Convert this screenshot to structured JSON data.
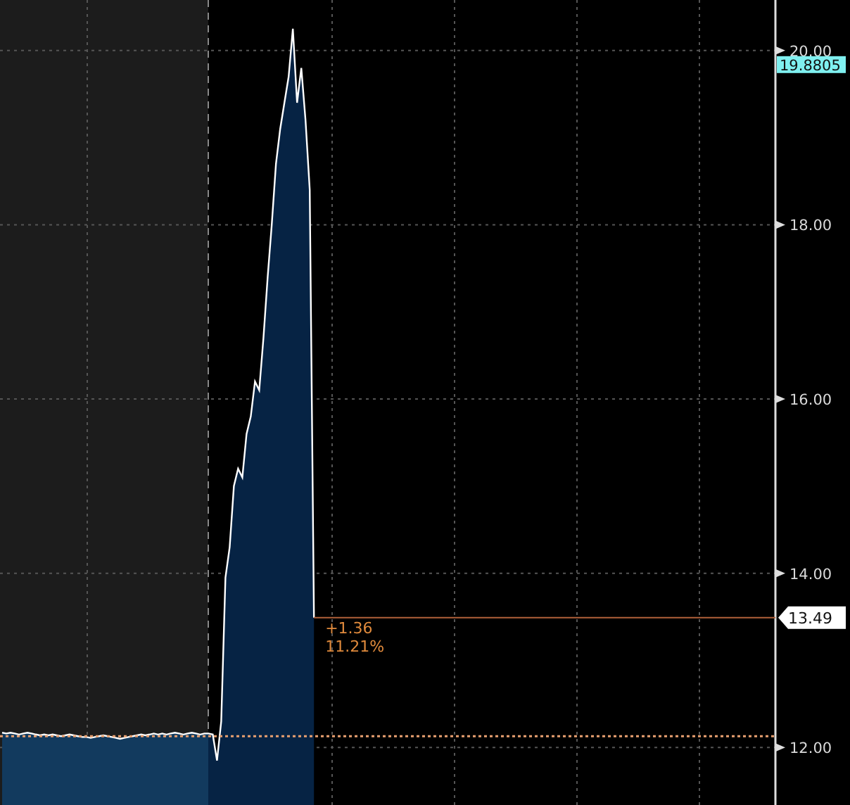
{
  "chart_data": {
    "type": "area",
    "ylim": [
      11.34,
      20.58
    ],
    "grid": true,
    "yticks": [
      {
        "value": 12,
        "label": "12.00"
      },
      {
        "value": 14,
        "label": "14.00"
      },
      {
        "value": 16,
        "label": "16.00"
      },
      {
        "value": 18,
        "label": "18.00"
      },
      {
        "value": 20,
        "label": "20.00"
      }
    ],
    "categories": [
      null,
      null,
      null,
      null,
      null,
      null,
      null,
      null,
      null,
      null,
      null,
      null,
      null,
      null,
      null,
      null,
      null,
      null,
      null,
      null,
      null,
      null,
      null,
      null,
      null,
      null,
      null,
      null,
      null,
      null,
      null,
      null,
      null,
      null,
      null,
      null,
      null,
      null,
      null,
      null,
      null,
      null,
      null,
      null,
      null,
      null,
      null,
      null,
      null,
      null,
      null,
      null,
      null,
      null,
      null,
      null,
      null,
      null,
      null,
      null,
      null,
      null,
      null,
      null,
      null,
      null,
      null,
      null,
      null,
      null,
      null,
      null,
      null,
      null,
      null,
      null,
      null,
      null,
      null,
      null,
      null,
      null,
      null,
      null,
      null,
      null,
      null,
      null,
      null,
      null,
      null,
      null,
      null,
      null,
      null,
      null,
      null,
      null,
      null,
      null,
      null,
      null,
      null,
      null,
      null,
      null,
      null,
      null,
      null,
      null,
      null,
      null,
      null,
      null,
      null,
      null,
      null,
      null,
      null,
      null,
      null,
      null,
      null,
      null,
      null,
      null,
      null,
      null,
      null,
      null,
      null,
      null,
      null,
      null,
      null,
      null,
      null,
      null,
      null,
      null,
      null,
      null,
      null,
      null,
      null,
      null,
      null,
      null,
      null,
      null,
      null,
      null,
      null,
      null,
      null,
      null,
      null,
      null,
      null,
      null,
      null,
      null,
      null,
      null,
      null,
      null,
      null,
      null,
      null,
      null,
      null,
      null,
      null,
      null,
      null,
      null,
      null,
      null,
      null,
      null,
      null,
      null,
      null,
      null
    ],
    "series": [
      {
        "color": "#ffffff",
        "values": [
          12.17,
          12.16,
          12.17,
          12.16,
          12.15,
          12.16,
          12.17,
          12.16,
          12.15,
          12.14,
          12.15,
          12.14,
          12.15,
          12.14,
          12.13,
          12.14,
          12.15,
          12.14,
          12.13,
          12.12,
          12.12,
          12.11,
          12.12,
          12.13,
          12.14,
          12.13,
          12.12,
          12.11,
          12.1,
          12.11,
          12.12,
          12.13,
          12.14,
          12.15,
          12.14,
          12.15,
          12.16,
          12.15,
          12.16,
          12.15,
          12.16,
          12.17,
          12.16,
          12.15,
          12.16,
          12.17,
          12.16,
          12.15,
          12.16,
          12.16,
          12.15,
          11.85,
          12.3,
          13.95,
          14.3,
          15.0,
          15.2,
          15.1,
          15.6,
          15.8,
          16.2,
          16.1,
          16.7,
          17.4,
          18.0,
          18.7,
          19.1,
          19.4,
          19.7,
          20.25,
          19.4,
          19.8,
          19.2,
          18.4,
          13.49,
          null,
          null,
          null,
          null,
          null,
          null,
          null,
          null,
          null,
          null,
          null,
          null,
          null,
          null,
          null,
          null,
          null,
          null,
          null,
          null,
          null,
          null,
          null,
          null,
          null,
          null,
          null,
          null,
          null,
          null,
          null,
          null,
          null,
          null,
          null,
          null,
          null,
          null,
          null,
          null,
          null,
          null,
          null,
          null,
          null,
          null,
          null,
          null,
          null,
          null,
          null,
          null,
          null,
          null,
          null,
          null,
          null,
          null,
          null,
          null,
          null,
          null,
          null,
          null,
          null,
          null,
          null,
          null,
          null,
          null,
          null,
          null,
          null,
          null,
          null,
          null,
          null,
          null,
          null,
          null,
          null,
          null,
          null,
          null,
          null,
          null,
          null,
          null,
          null,
          null,
          null,
          null,
          null,
          null,
          null,
          null,
          null,
          null,
          null,
          null,
          null,
          null,
          null,
          null,
          null,
          null,
          null,
          null,
          null
        ]
      }
    ],
    "ref_lines": [
      {
        "axis": "y",
        "value": 12.13,
        "color": "#e8a070"
      },
      {
        "axis": "y",
        "value": 13.49,
        "label": "13.49",
        "color": "#b0603a"
      }
    ],
    "annotations": [
      "+1.36",
      "11.21%",
      "19.8805"
    ]
  }
}
